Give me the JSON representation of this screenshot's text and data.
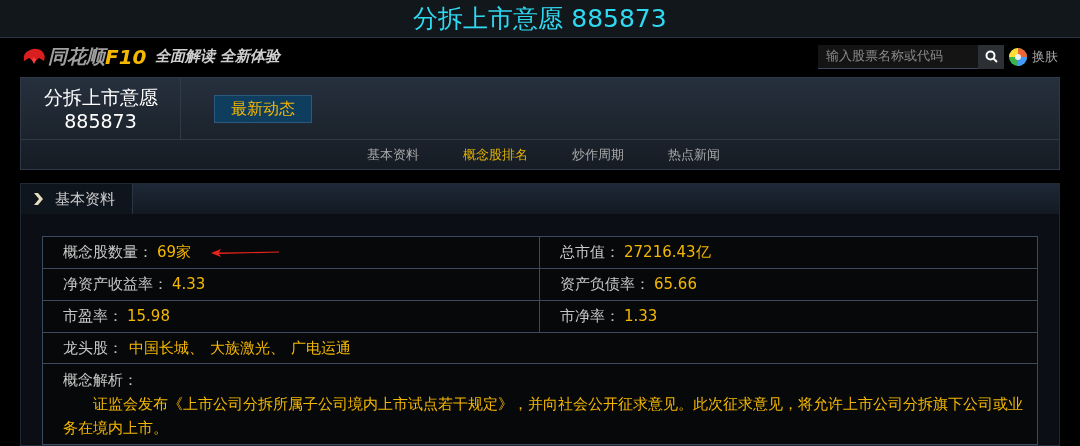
{
  "window": {
    "title": "分拆上市意愿 885873"
  },
  "header": {
    "logo_name": "同花顺",
    "logo_code": "F10",
    "slogan": "全面解读 全新体验",
    "search": {
      "placeholder": "输入股票名称或代码"
    },
    "skin_label": "换肤"
  },
  "stock": {
    "name": "分拆上市意愿",
    "code": "885873",
    "button": "最新动态"
  },
  "tabs": [
    {
      "label": "基本资料",
      "selected": false
    },
    {
      "label": "概念股排名",
      "selected": true
    },
    {
      "label": "炒作周期",
      "selected": false
    },
    {
      "label": "热点新闻",
      "selected": false
    }
  ],
  "section": {
    "title": "基本资料"
  },
  "table": {
    "rows": [
      [
        {
          "label": "概念股数量：",
          "value": "69家",
          "annotated": true
        },
        {
          "label": "总市值：",
          "value": "27216.43亿",
          "annotated": false
        }
      ],
      [
        {
          "label": "净资产收益率：",
          "value": "4.33",
          "annotated": false
        },
        {
          "label": "资产负债率：",
          "value": "65.66",
          "annotated": false
        }
      ],
      [
        {
          "label": "市盈率：",
          "value": "15.98",
          "annotated": false
        },
        {
          "label": "市净率：",
          "value": "1.33",
          "annotated": false
        }
      ]
    ],
    "leaders": {
      "label": "龙头股：",
      "values": [
        "中国长城、",
        "大族激光、",
        "广电运通"
      ]
    },
    "analysis": {
      "label": "概念解析：",
      "text": "证监会发布《上市公司分拆所属子公司境内上市试点若干规定》，并向社会公开征求意见。此次征求意见，将允许上市公司分拆旗下公司或业务在境内上市。"
    }
  }
}
